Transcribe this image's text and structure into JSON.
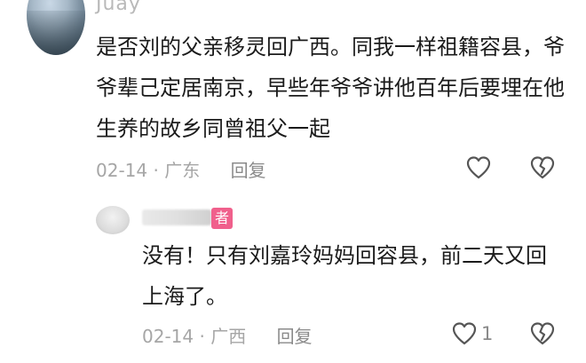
{
  "comment": {
    "username": "Juay",
    "text": "是否刘的父亲移灵回广西。同我一样祖籍容县，爷爷辈己定居南京，早些年爷爷讲他百年后要埋在他生养的故乡同曾祖父一起",
    "date": "02-14",
    "location": "广东",
    "separator": "·",
    "reply_label": "回复"
  },
  "reply": {
    "badge": "者",
    "text": "没有！只有刘嘉玲妈妈回容县，前二天又回上海了。",
    "date": "02-14",
    "location": "广西",
    "separator": "·",
    "reply_label": "回复",
    "like_count": "1"
  },
  "icons": {
    "like": "heart-outline-icon",
    "dislike": "broken-heart-outline-icon"
  }
}
